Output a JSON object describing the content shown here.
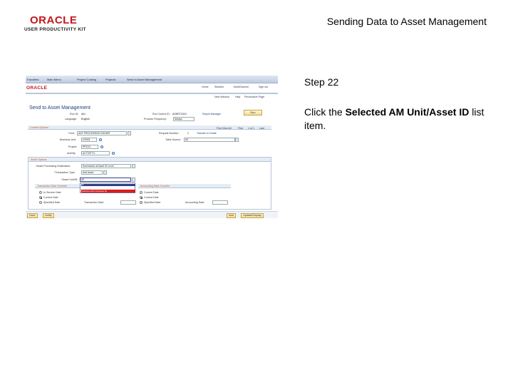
{
  "header": {
    "logo_word": "ORACLE",
    "logo_sub": "USER PRODUCTIVITY KIT",
    "title": "Sending Data to Asset Management"
  },
  "step": {
    "title": "Step 22",
    "instruction_pre": "Click the ",
    "instruction_bold": "Selected AM Unit/Asset ID",
    "instruction_post": " list item."
  },
  "screenshot": {
    "nav_tabs": [
      "Favorites",
      "Main Menu",
      "Project Costing",
      "Projects",
      "Send to Asset Management"
    ],
    "brand": "ORACLE",
    "header_links": [
      "Home",
      "Worklist",
      "MultiChannel",
      "Sign out"
    ],
    "sub_links": [
      "New Window",
      "Help",
      "Personalize Page"
    ],
    "page_title": "Send to Asset Management",
    "fields": {
      "run_id_label": "Run ID:",
      "run_id_value": "dh1",
      "language_label": "Language:",
      "language_value": "English",
      "run_control_label": "Run Control ID:",
      "run_control_value": "ASSET1010",
      "report_mgr": "Report Manager",
      "recurrence_label": "Process Frequency:",
      "recurrence_value": "Always",
      "run_button": "Run",
      "content_header": "Content Options",
      "find": "Find",
      "view_all": "View All",
      "first": "First",
      "of": "1 of 1",
      "last": "Last",
      "unit_label": "*Unit:",
      "unit_value": "ANY PROCESSING SHOWS",
      "request_number_label": "Request Number:",
      "request_number_value": "1",
      "cross_unit_label": "Transfer to Detail",
      "business_unit_label": "Business Unit:",
      "business_unit_value": "US004",
      "project_label": "Project:",
      "project_value": "PROJ4",
      "activity_label": "Activity:",
      "activity_value": "ACTIVITY1",
      "table_source_label": "Table Source:",
      "table_source_value": "All",
      "asset_options_header": "Asset Options",
      "asset_dest_label": "*Asset Processing Destination:",
      "asset_dest_value": "Summarize at Asset ID Level",
      "transaction_type_label": "*Transaction Type:",
      "transaction_type_value": "Add Asset",
      "asset_unit_label": "*Asset Unit/ID:",
      "asset_unit_value": "All",
      "transaction_date_header": "Transaction Date Override",
      "accounting_date_header": "Accounting Date Override",
      "current_date": "Current Date",
      "specified_date": "Specified Date",
      "transaction_date_label": "Transaction Date:",
      "accounting_date_label": "Accounting Date:",
      "in_service": "In Service Date",
      "options": [
        "All",
        "Selected AM Unit/Asset ID"
      ]
    },
    "footer": {
      "save": "Save",
      "notify": "Notify",
      "add": "Add",
      "update": "Update/Display"
    }
  },
  "colors": {
    "brand_red": "#c4161c",
    "highlight_red": "#e00000",
    "link_blue": "#1d3d7a"
  }
}
